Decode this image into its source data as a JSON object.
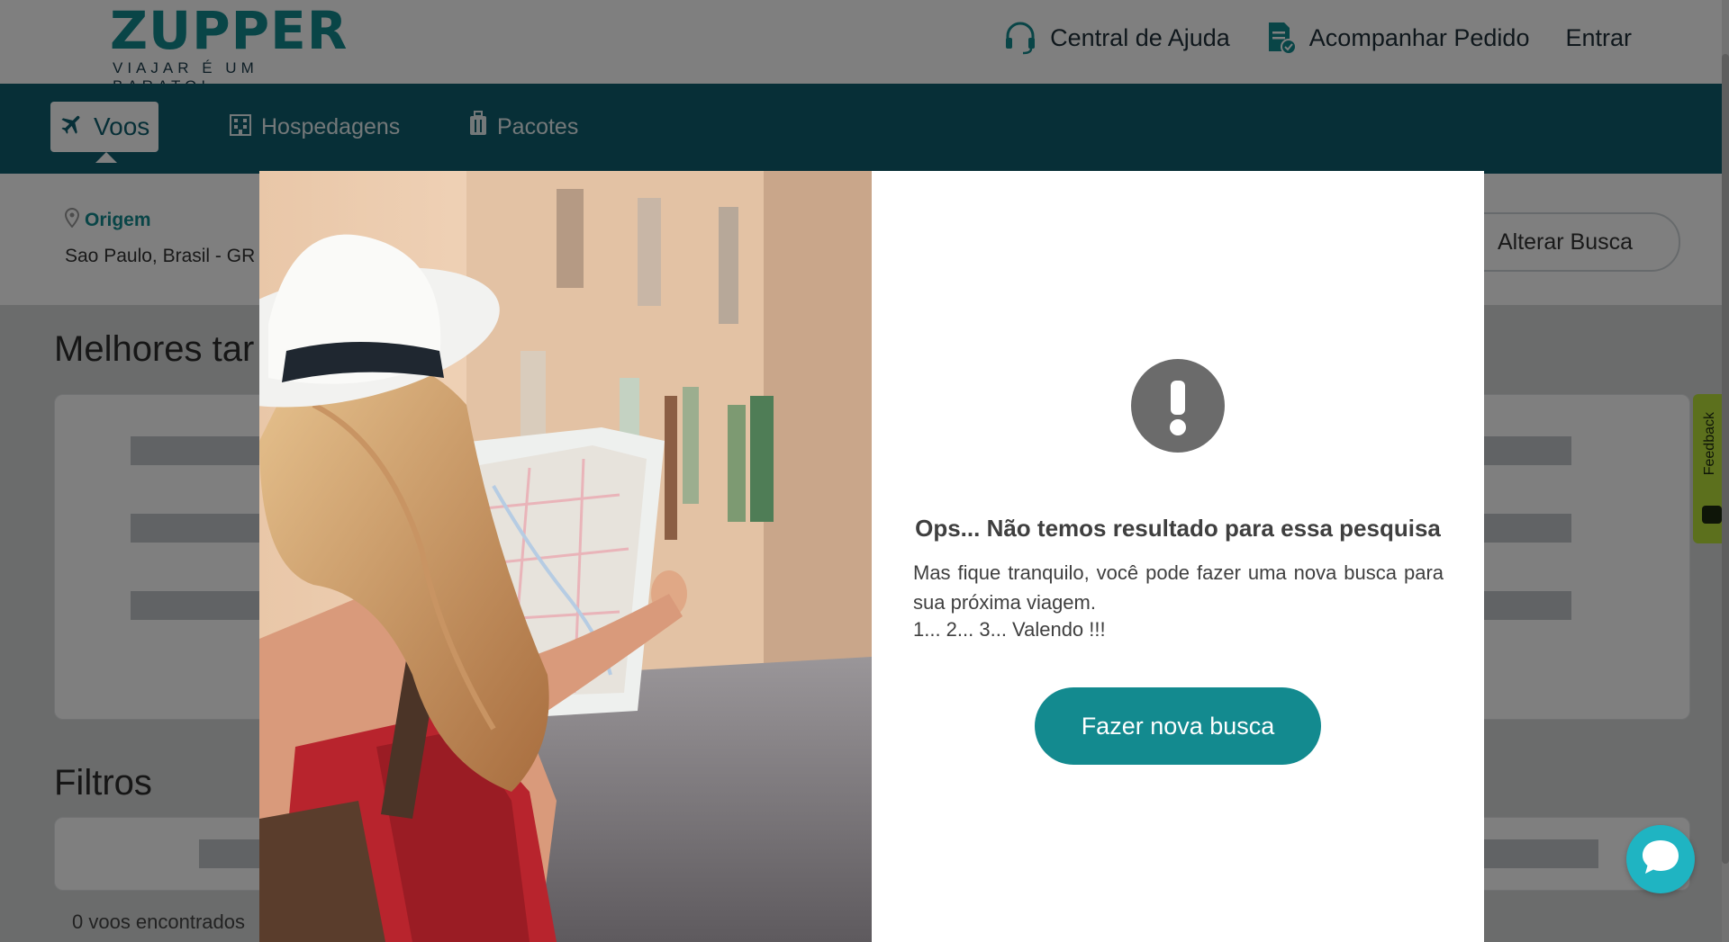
{
  "brand": {
    "logo_text": "ZUPPER",
    "tagline": "VIAJAR É UM BARATO!"
  },
  "top_nav": {
    "help_label": "Central de Ajuda",
    "track_label": "Acompanhar Pedido",
    "login_label": "Entrar"
  },
  "tabs": [
    {
      "label": "Voos",
      "icon": "airplane-icon",
      "active": true
    },
    {
      "label": "Hospedagens",
      "icon": "building-icon",
      "active": false
    },
    {
      "label": "Pacotes",
      "icon": "luggage-icon",
      "active": false
    }
  ],
  "search": {
    "origin_label": "Origem",
    "origin_value": "Sao Paulo, Brasil - GR",
    "alter_button": "Alterar Busca"
  },
  "page": {
    "best_fares_title": "Melhores tar",
    "filters_title": "Filtros",
    "results_count": "0 voos encontrados"
  },
  "feedback_label": "Feedback",
  "modal": {
    "title": "Ops... Não temos resultado para essa pesquisa",
    "body": "Mas fique tranquilo, você pode fazer uma nova busca para sua próxima viagem.",
    "line3": "1... 2... 3... Valendo !!!",
    "cta_label": "Fazer nova busca"
  },
  "colors": {
    "brand_teal": "#138a8f",
    "nav_dark_teal": "#0f5f6e",
    "chat_blue": "#1fb4c2",
    "feedback_green": "#b9e03a"
  }
}
